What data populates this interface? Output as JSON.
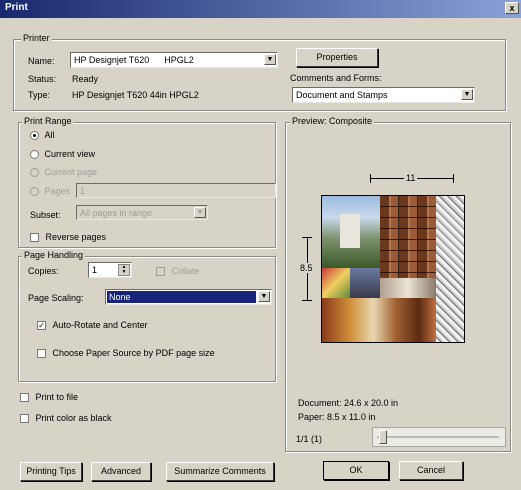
{
  "window": {
    "title": "Print",
    "close_label": "x"
  },
  "printer": {
    "group_label": "Printer",
    "name_label": "Name:",
    "name_value": "HP Designjet T620      HPGL2",
    "status_label": "Status:",
    "status_value": "Ready",
    "type_label": "Type:",
    "type_value": "HP Designjet T620 44in HPGL2",
    "properties_button": "Properties",
    "comments_label": "Comments and Forms:",
    "comments_value": "Document and Stamps"
  },
  "print_range": {
    "group_label": "Print Range",
    "all": "All",
    "current_view": "Current view",
    "current_page": "Current page",
    "pages": "Pages",
    "pages_value": "1",
    "subset_label": "Subset:",
    "subset_value": "All pages in range",
    "reverse_pages": "Reverse pages"
  },
  "page_handling": {
    "group_label": "Page Handling",
    "copies_label": "Copies:",
    "copies_value": "1",
    "collate": "Collate",
    "scaling_label": "Page Scaling:",
    "scaling_value": "None",
    "auto_rotate": "Auto-Rotate and Center",
    "choose_source": "Choose Paper Source by PDF page size"
  },
  "options": {
    "print_to_file": "Print to file",
    "print_color_black": "Print color as black"
  },
  "preview": {
    "group_label": "Preview: Composite",
    "width_label": "11",
    "height_label": "8.5",
    "document_size": "Document: 24.6 x 20.0 in",
    "paper_size": "Paper: 8.5 x 11.0 in",
    "page_counter": "1/1 (1)"
  },
  "buttons": {
    "printing_tips": "Printing Tips",
    "advanced": "Advanced",
    "summarize": "Summarize Comments",
    "ok": "OK",
    "cancel": "Cancel"
  }
}
